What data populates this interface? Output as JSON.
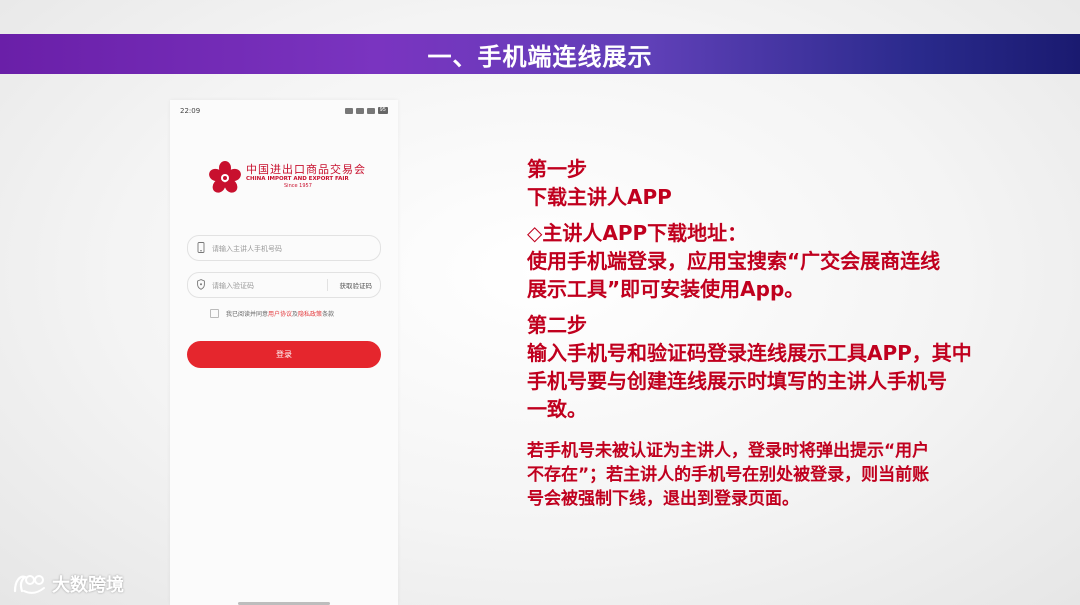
{
  "slide": {
    "title": "一、手机端连线展示"
  },
  "phone": {
    "status_time": "22:09",
    "battery": "95",
    "logo": {
      "cn": "中国进出口商品交易会",
      "en": "CHINA IMPORT AND EXPORT FAIR",
      "since": "Since 1957"
    },
    "phone_placeholder": "请输入主讲人手机号码",
    "code_placeholder": "请输入验证码",
    "get_code_label": "获取验证码",
    "agreement": {
      "prefix": "我已阅读并同意",
      "user_agreement": "用户协议",
      "and": "及",
      "privacy_policy": "隐私政策",
      "suffix": "条款"
    },
    "login_label": "登录"
  },
  "instructions": {
    "step1_title": "第一步",
    "step1_desc": "下载主讲人APP",
    "download_heading": "◇主讲人APP下载地址：",
    "download_line1": "使用手机端登录，应用宝搜索“广交会展商连线",
    "download_line2": "展示工具”即可安装使用App。",
    "step2_title": "第二步",
    "step2_line1": "输入手机号和验证码登录连线展示工具APP，其中",
    "step2_line2": "手机号要与创建连线展示时填写的主讲人手机号",
    "step2_line3": "一致。",
    "note_line1": "若手机号未被认证为主讲人，登录时将弹出提示“用户",
    "note_line2": "不存在”；若主讲人的手机号在别处被登录，则当前账",
    "note_line3": "号会被强制下线，退出到登录页面。"
  },
  "watermark": {
    "text": "大数跨境"
  },
  "colors": {
    "title_gradient_start": "#6a1fa8",
    "title_gradient_end": "#1a1a70",
    "instruction_red": "#c0001e",
    "login_button": "#e5262d"
  }
}
